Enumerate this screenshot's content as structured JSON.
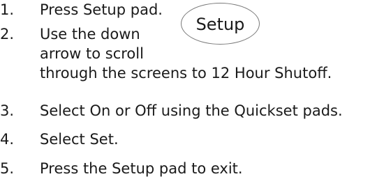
{
  "steps": [
    {
      "number": "1.",
      "lines": [
        "Press Setup pad."
      ]
    },
    {
      "number": "2.",
      "lines": [
        "Use the down",
        "arrow to scroll",
        "through the screens to 12 Hour Shutoff."
      ]
    },
    {
      "number": "3.",
      "lines": [
        "Select On or Off using the Quickset pads."
      ]
    },
    {
      "number": "4.",
      "lines": [
        "Select Set."
      ]
    },
    {
      "number": "5.",
      "lines": [
        "Press the Setup pad to exit."
      ]
    }
  ],
  "setup_pad": {
    "label": "Setup"
  }
}
